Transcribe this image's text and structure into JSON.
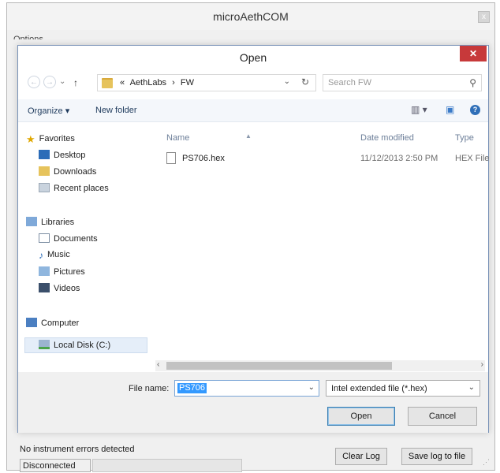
{
  "app": {
    "title": "microAethCOM",
    "close_glyph": "x",
    "menu_label": "Options",
    "status_message": "No instrument errors detected",
    "connection_status": "Disconnected",
    "clear_log_label": "Clear Log",
    "save_log_label": "Save log to file"
  },
  "dialog": {
    "title": "Open",
    "close_glyph": "✕",
    "address": {
      "chevron": "«",
      "segments": [
        "AethLabs",
        "›",
        "FW"
      ],
      "refresh_glyph": "↻"
    },
    "search_placeholder": "Search FW",
    "toolbar": {
      "organize_label": "Organize ▾",
      "new_folder_label": "New folder",
      "help_glyph": "?"
    },
    "nav": {
      "favorites_label": "Favorites",
      "desktop_label": "Desktop",
      "downloads_label": "Downloads",
      "recent_label": "Recent places",
      "libraries_label": "Libraries",
      "documents_label": "Documents",
      "music_label": "Music",
      "pictures_label": "Pictures",
      "videos_label": "Videos",
      "computer_label": "Computer",
      "local_disk_label": "Local Disk (C:)"
    },
    "columns": {
      "name": "Name",
      "date": "Date modified",
      "type": "Type"
    },
    "files": [
      {
        "name": "PS706.hex",
        "date": "11/12/2013 2:50 PM",
        "type": "HEX File"
      }
    ],
    "file_name_label": "File name:",
    "file_name_value": "PS706",
    "file_type_value": "Intel extended file (*.hex)",
    "open_label": "Open",
    "cancel_label": "Cancel"
  },
  "colors": {
    "close_red": "#c7393a",
    "selection_blue": "#3399ff",
    "link_text": "#1e3a5c"
  }
}
